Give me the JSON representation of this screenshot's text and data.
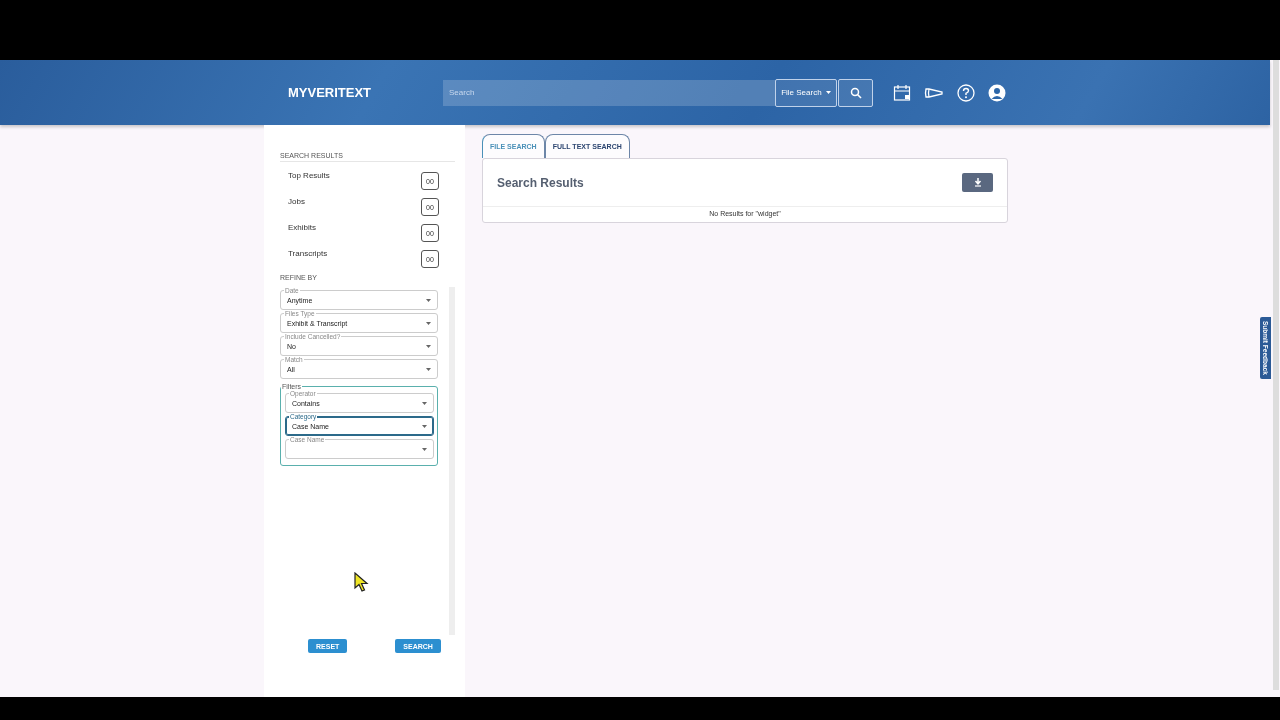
{
  "header": {
    "logo": "MYVERITEXT",
    "search": {
      "placeholder": "Search"
    },
    "scope": "File Search"
  },
  "sidebar": {
    "results_title": "SEARCH RESULTS",
    "results": [
      {
        "label": "Top Results",
        "count": "00"
      },
      {
        "label": "Jobs",
        "count": "00"
      },
      {
        "label": "Exhibits",
        "count": "00"
      },
      {
        "label": "Transcripts",
        "count": "00"
      }
    ],
    "refine_title": "REFINE BY",
    "selects": [
      {
        "label": "Date",
        "value": "Anytime",
        "focused": false
      },
      {
        "label": "Files Type",
        "value": "Exhibit & Transcript",
        "focused": false
      },
      {
        "label": "Include Cancelled?",
        "value": "No",
        "focused": false
      },
      {
        "label": "Match",
        "value": "All",
        "focused": false
      }
    ],
    "filters": {
      "title": "Filters",
      "selects": [
        {
          "label": "Operator",
          "value": "Contains",
          "focused": false
        },
        {
          "label": "Category",
          "value": "Case Name",
          "focused": true
        },
        {
          "label": "Case Name",
          "focused": false
        }
      ]
    },
    "buttons": [
      "RESET",
      "SEARCH"
    ]
  },
  "tabs": [
    {
      "label": "FILE SEARCH",
      "selected": true
    },
    {
      "label": "FULL TEXT SEARCH",
      "selected": false
    }
  ],
  "results": {
    "title": "Search Results",
    "message": "No Results for \"widget\""
  },
  "feedback": "Submit Feedback"
}
